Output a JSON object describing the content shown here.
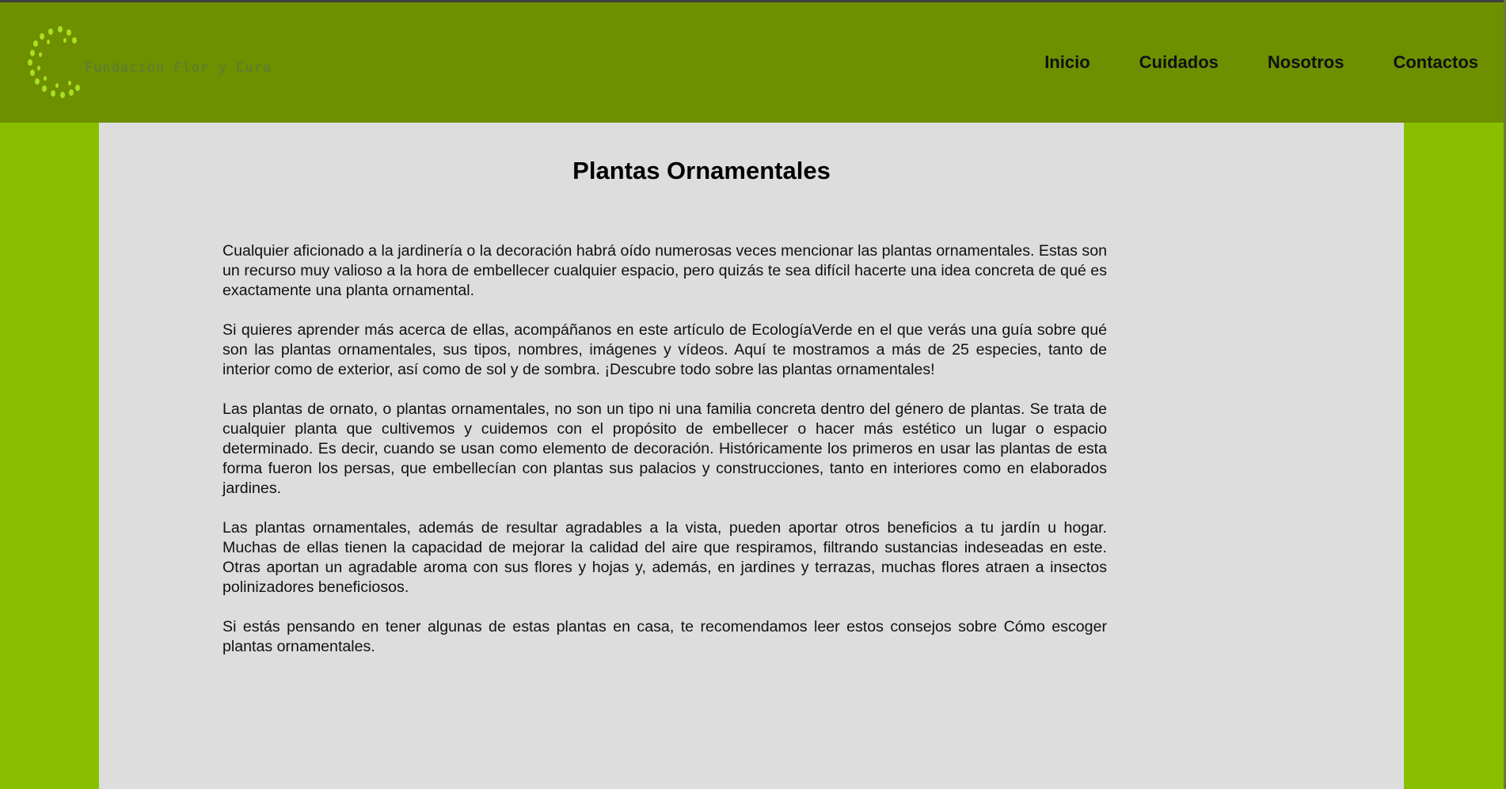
{
  "header": {
    "brand": "Fundación Flor y Cura",
    "nav": [
      "Inicio",
      "Cuidados",
      "Nosotros",
      "Contactos"
    ]
  },
  "main": {
    "title": "Plantas Ornamentales",
    "paragraphs": [
      "Cualquier aficionado a la jardinería o la decoración habrá oído numerosas veces mencionar las plantas ornamentales. Estas son un recurso muy valioso a la hora de embellecer cualquier espacio, pero quizás te sea difícil hacerte una idea concreta de qué es exactamente una planta ornamental.",
      "Si quieres aprender más acerca de ellas, acompáñanos en este artículo de EcologíaVerde en el que verás una guía sobre qué son las plantas ornamentales, sus tipos, nombres, imágenes y vídeos. Aquí te mostramos a más de 25 especies, tanto de interior como de exterior, así como de sol y de sombra. ¡Descubre todo sobre las plantas ornamentales!",
      "Las plantas de ornato, o plantas ornamentales, no son un tipo ni una familia concreta dentro del género de plantas. Se trata de cualquier planta que cultivemos y cuidemos con el propósito de embellecer o hacer más estético un lugar o espacio determinado. Es decir, cuando se usan como elemento de decoración. Históricamente los primeros en usar las plantas de esta forma fueron los persas, que embellecían con plantas sus palacios y construcciones, tanto en interiores como en elaborados jardines.",
      "Las plantas ornamentales, además de resultar agradables a la vista, pueden aportar otros beneficios a tu jardín u hogar. Muchas de ellas tienen la capacidad de mejorar la calidad del aire que respiramos, filtrando sustancias indeseadas en este. Otras aportan un agradable aroma con sus flores y hojas y, además, en jardines y terrazas, muchas flores atraen a insectos polinizadores beneficiosos.",
      "Si estás pensando en tener algunas de estas plantas en casa, te recomendamos leer estos consejos sobre Cómo escoger plantas ornamentales."
    ]
  },
  "colors": {
    "header_bg": "#6e8f00",
    "page_bg": "#88c000",
    "content_bg": "#dddddd",
    "logo_dots": "#a8e020"
  },
  "icons": {
    "logo": "dotted-circle-logo-icon"
  }
}
